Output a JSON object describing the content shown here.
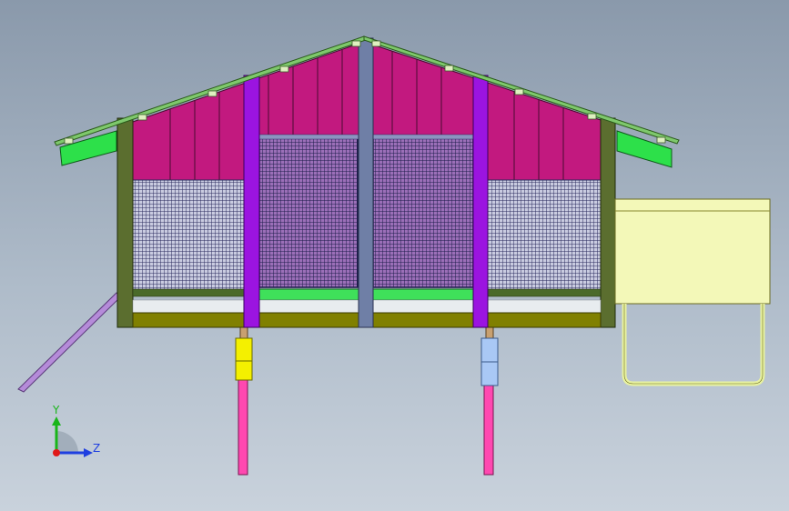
{
  "view": {
    "background_top": "#8a99ab",
    "background_bottom": "#c9d2dc"
  },
  "model": {
    "roof_panel_color": "#c2197f",
    "mesh_color": "#2b2b5e",
    "post_color": "#9b14e0",
    "center_post_color": "#6f7fa6",
    "frame_color": "#5b6e2f",
    "floor_color": "#808000",
    "tray_color": "#3fe05a",
    "nest_box_color": "#f3f8b8",
    "left_leg_color": "#ff48b0",
    "left_connector_color": "#f4f000",
    "right_connector_color": "#a9c8f5"
  },
  "triad": {
    "y_label": "Y",
    "z_label": "Z",
    "y_color": "#19b519",
    "z_color": "#1f3fe0",
    "origin_color": "#e01818"
  }
}
